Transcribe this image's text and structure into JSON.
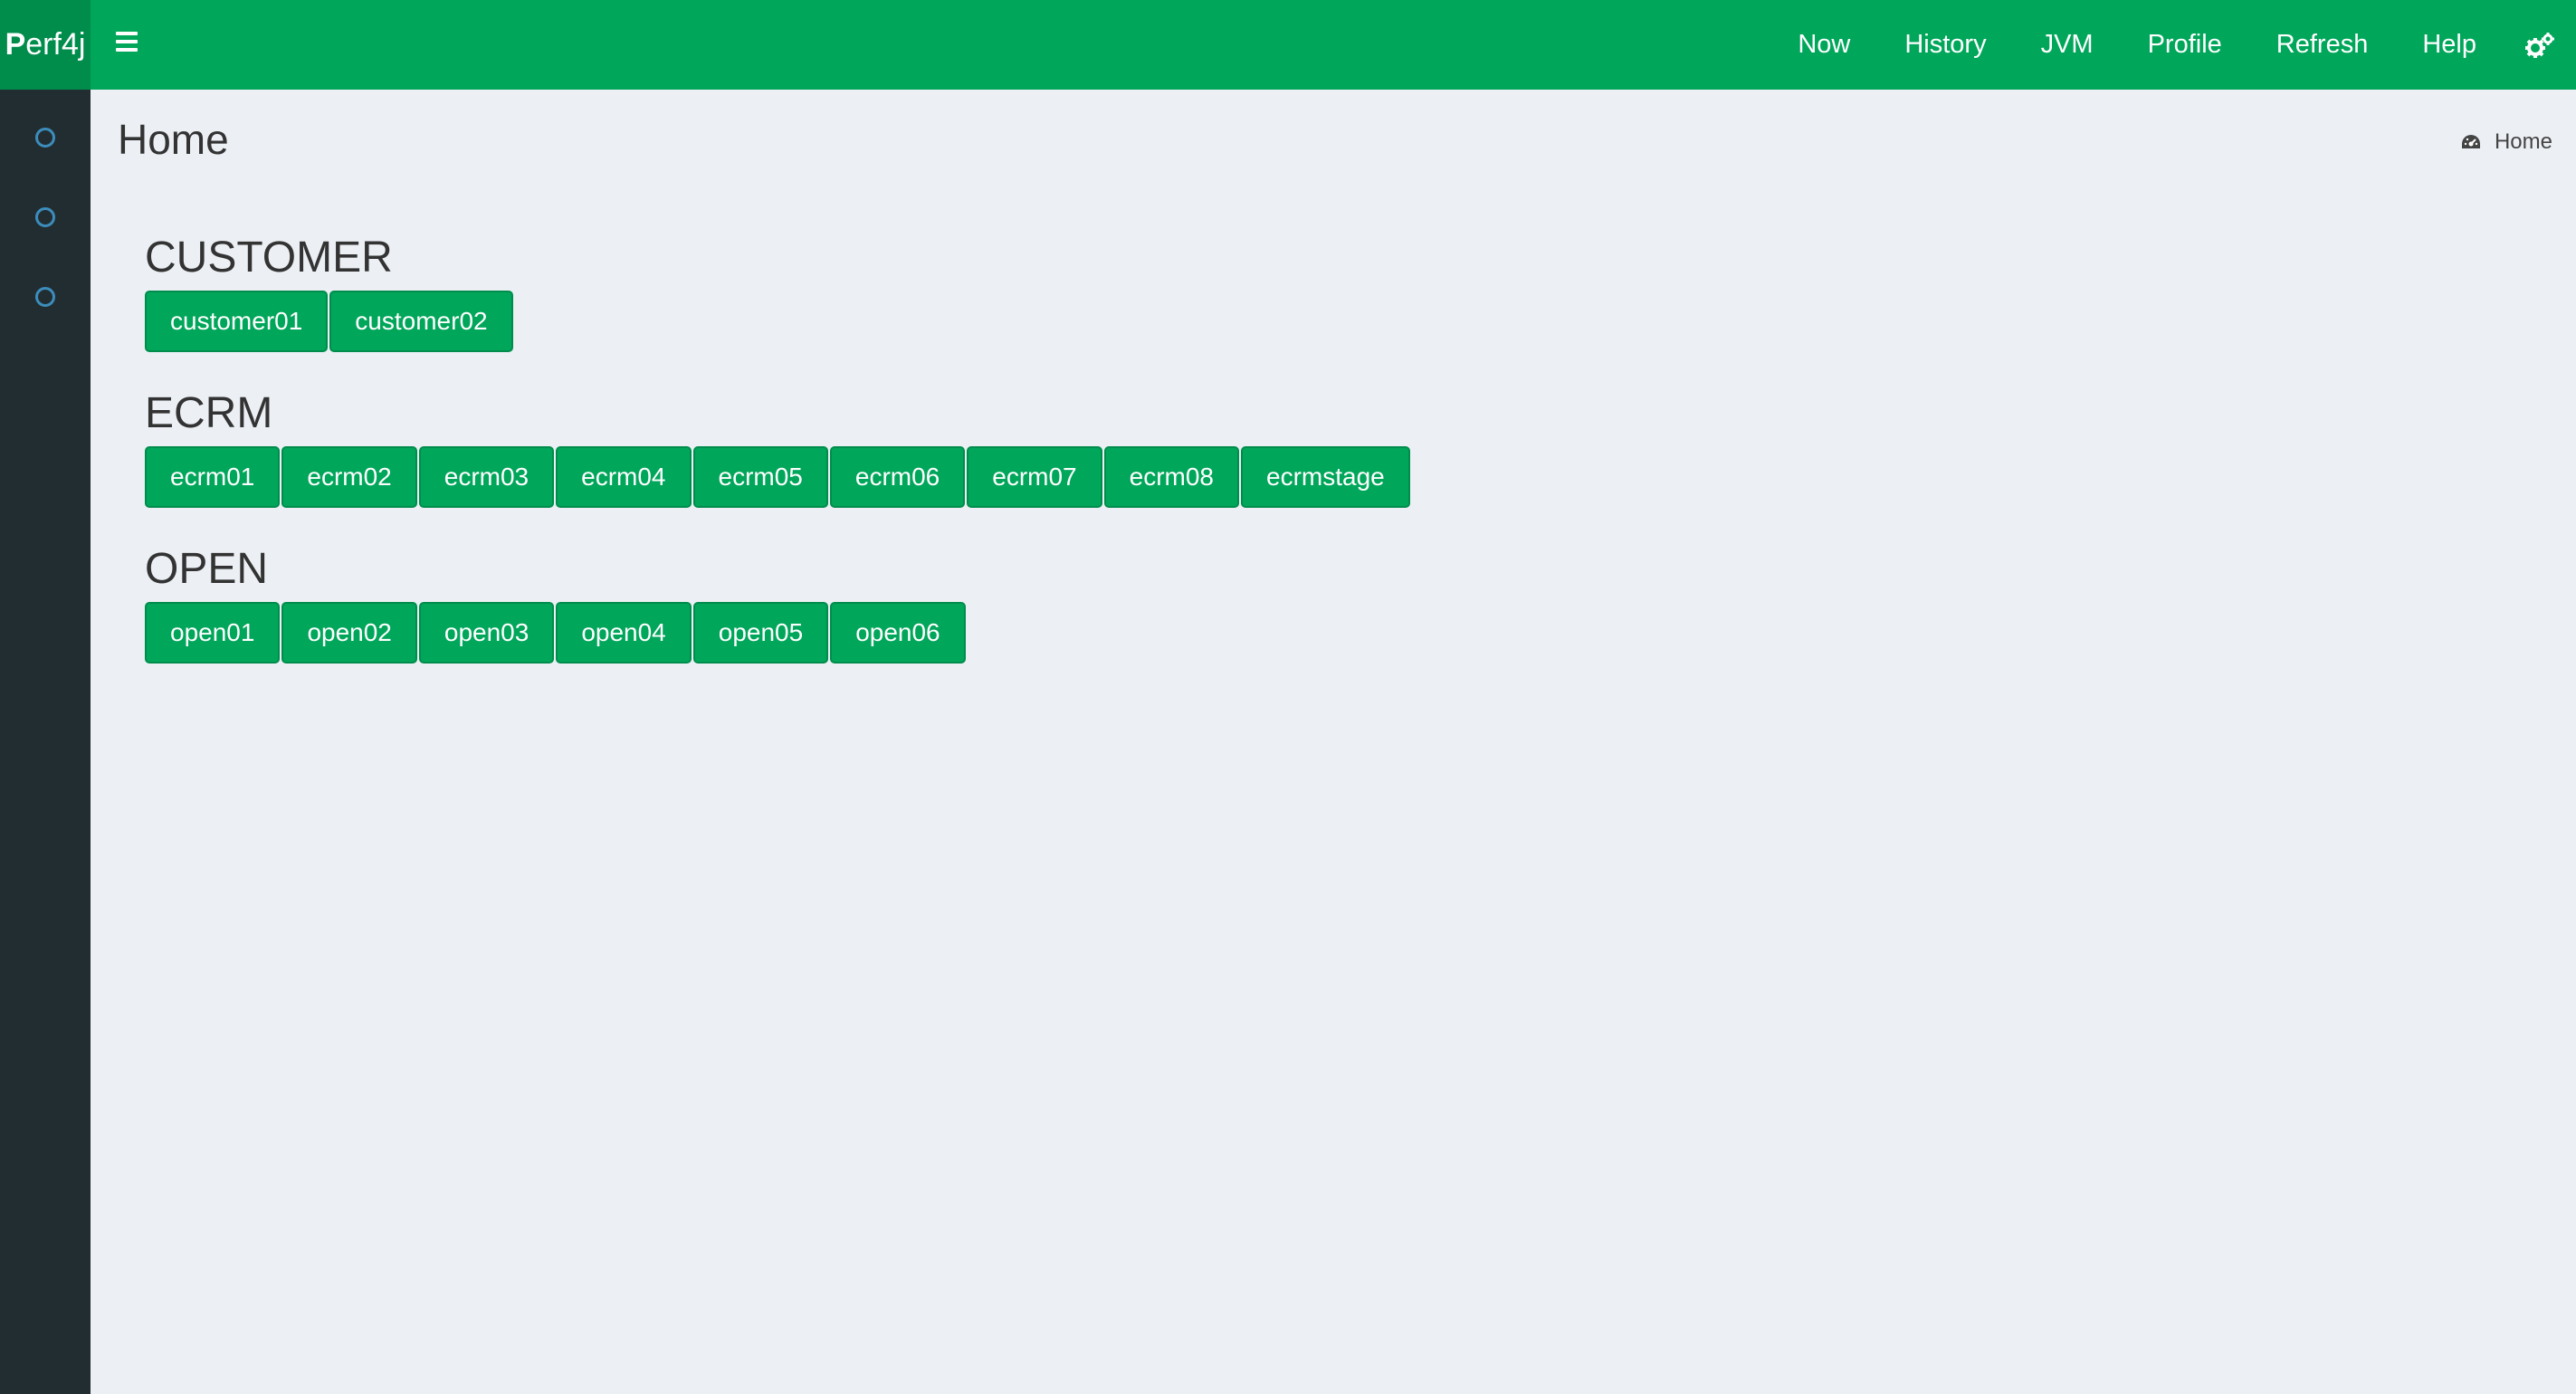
{
  "header": {
    "logo": {
      "bold": "P",
      "rest": "erf4j"
    },
    "nav": [
      {
        "label": "Now"
      },
      {
        "label": "History"
      },
      {
        "label": "JVM"
      },
      {
        "label": "Profile"
      },
      {
        "label": "Refresh"
      },
      {
        "label": "Help"
      }
    ],
    "settings_icon": "gears-icon",
    "menu_icon": "hamburger-icon"
  },
  "sidebar": {
    "items": [
      {
        "icon": "circle-outline-icon"
      },
      {
        "icon": "circle-outline-icon"
      },
      {
        "icon": "circle-outline-icon"
      }
    ]
  },
  "page": {
    "title": "Home",
    "breadcrumb": {
      "icon": "dashboard-icon",
      "label": "Home"
    }
  },
  "groups": [
    {
      "title": "CUSTOMER",
      "hosts": [
        "customer01",
        "customer02"
      ]
    },
    {
      "title": "ECRM",
      "hosts": [
        "ecrm01",
        "ecrm02",
        "ecrm03",
        "ecrm04",
        "ecrm05",
        "ecrm06",
        "ecrm07",
        "ecrm08",
        "ecrmstage"
      ]
    },
    {
      "title": "OPEN",
      "hosts": [
        "open01",
        "open02",
        "open03",
        "open04",
        "open05",
        "open06"
      ]
    }
  ],
  "colors": {
    "primary": "#00a65a",
    "primary_dark": "#008d4c",
    "sidebar": "#222d32",
    "background": "#ecf0f5",
    "sidebar_icon": "#3c8dbc"
  }
}
